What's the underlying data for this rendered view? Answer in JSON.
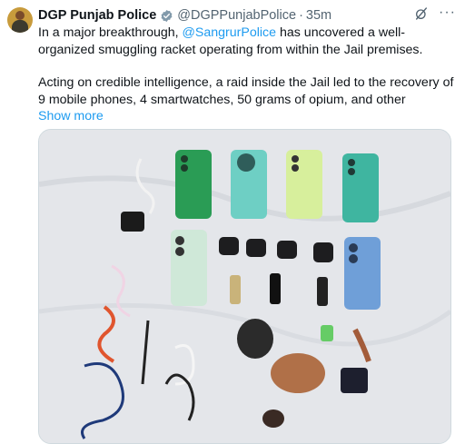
{
  "post": {
    "author_name": "DGP Punjab Police",
    "handle": "@DGPPunjabPolice",
    "separator": "·",
    "time": "35m",
    "text_line1_prefix": "In a major breakthrough, ",
    "mention": "@SangrurPolice",
    "text_line1_suffix": " has uncovered a well-organized smuggling racket operating from within the Jail premises.",
    "text_para2": "Acting on credible intelligence, a raid inside the Jail led to the recovery of 9 mobile phones, 4 smartwatches, 50 grams of opium, and other",
    "show_more": "Show more"
  },
  "icons": {
    "verified": "verified-badge-icon",
    "grok": "grok-icon",
    "more": "more-options-icon"
  },
  "colors": {
    "link": "#1d9bf0",
    "secondary_text": "#536471",
    "verified_badge": "#829aab"
  }
}
